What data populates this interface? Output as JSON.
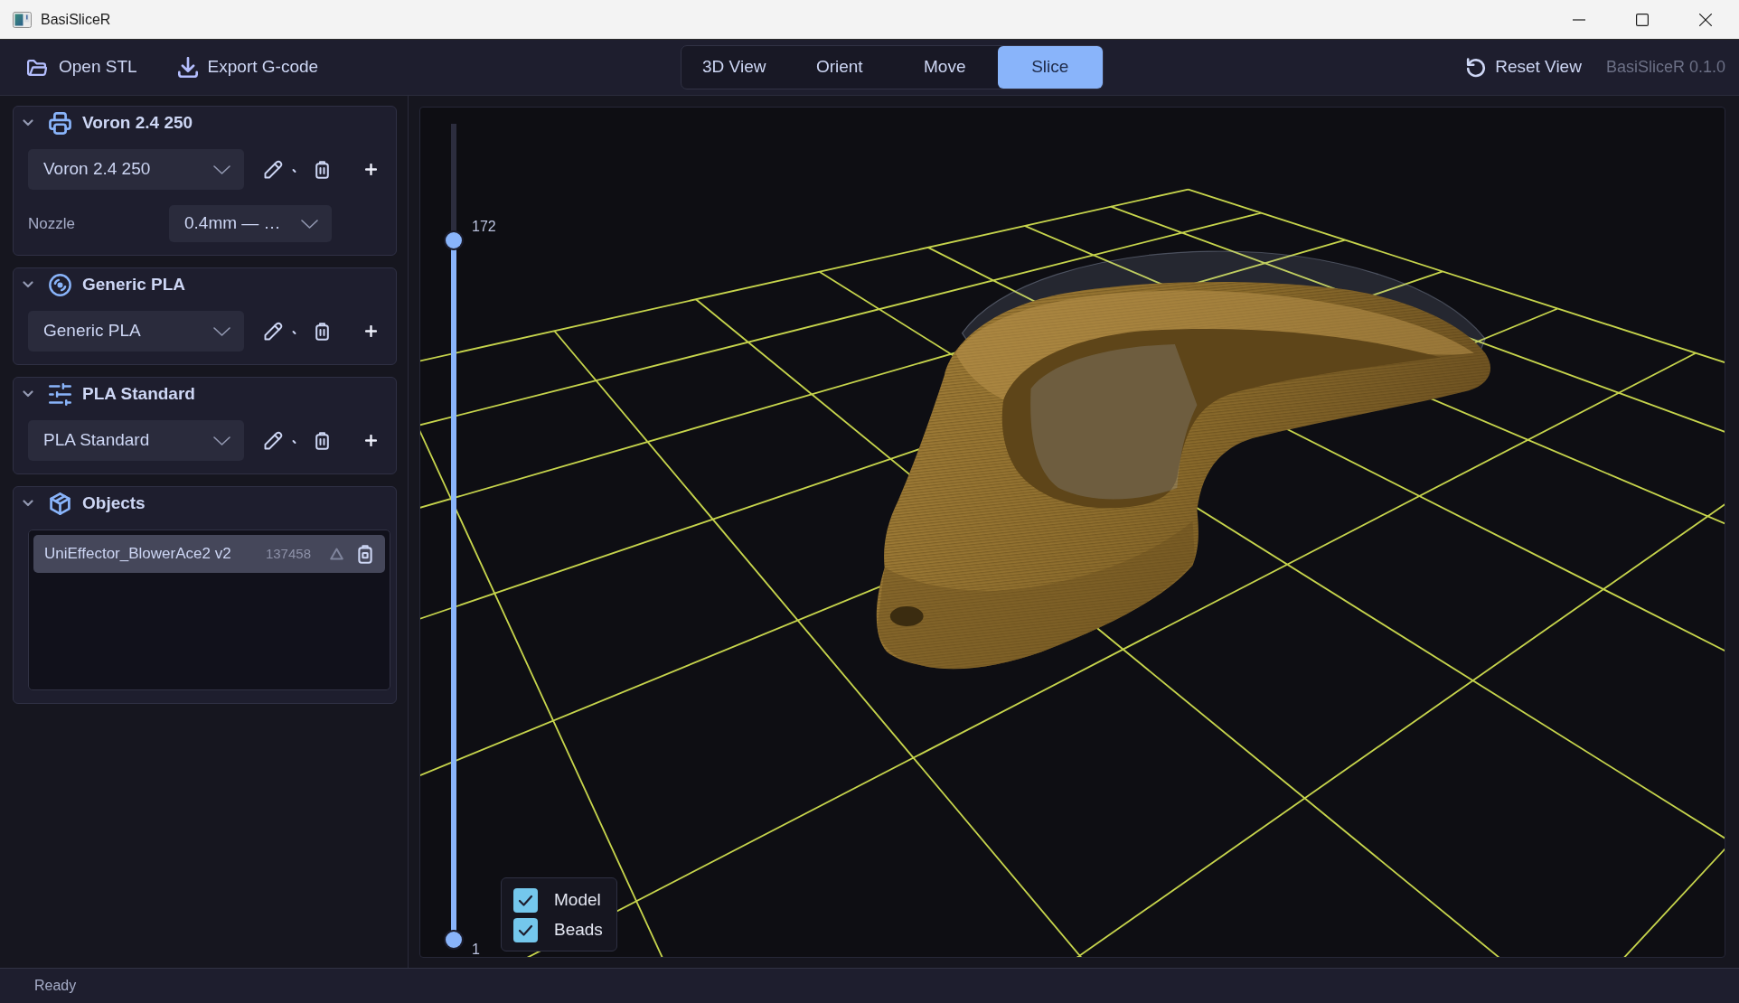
{
  "window": {
    "title": "BasiSliceR"
  },
  "toolbar": {
    "actions": [
      {
        "kind": "open",
        "label": "Open STL"
      },
      {
        "kind": "export",
        "label": "Export G-code"
      }
    ],
    "tabs": [
      {
        "label": "3D View",
        "selected": false
      },
      {
        "label": "Orient",
        "selected": false
      },
      {
        "label": "Move",
        "selected": false
      },
      {
        "label": "Slice",
        "selected": true
      }
    ],
    "reset_button": {
      "label": "Reset View"
    },
    "version": "BasiSliceR 0.1.0"
  },
  "sidebar": {
    "sections": [
      {
        "kind": "printer",
        "title": "Voron 2.4 250",
        "expanded": true,
        "preset": "Voron 2.4 250",
        "fields": [
          {
            "label": "Nozzle",
            "value": "0.4mm — …"
          }
        ]
      },
      {
        "kind": "filament",
        "title": "Generic PLA",
        "expanded": true,
        "preset": "Generic PLA"
      },
      {
        "kind": "process",
        "title": "PLA Standard",
        "expanded": true,
        "preset": "PLA Standard"
      },
      {
        "kind": "objects",
        "title": "Objects",
        "expanded": true,
        "objects": [
          {
            "name": "UniEffector_BlowerAce2 v2",
            "count": "137458",
            "selected": true
          }
        ]
      }
    ]
  },
  "viewport": {
    "layer_slider": {
      "thumbs": [
        {
          "label": "172",
          "level": 0.857
        },
        {
          "label": "1",
          "level": 0
        }
      ]
    },
    "display_toggles": [
      {
        "label": "Model",
        "checked": true
      },
      {
        "label": "Beads",
        "checked": true
      }
    ]
  },
  "status_bar": {
    "text": "Ready"
  }
}
